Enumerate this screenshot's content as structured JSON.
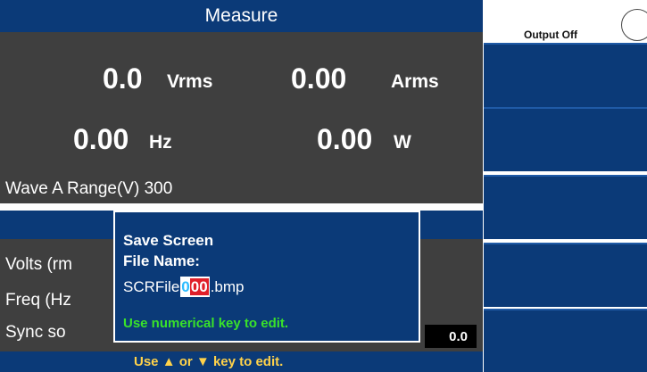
{
  "header": {
    "title": "Measure",
    "output_label": "Output Off"
  },
  "measure": {
    "voltage": {
      "value": "0.0",
      "unit": "Vrms"
    },
    "current": {
      "value": "0.00",
      "unit": "Arms"
    },
    "frequency": {
      "value": "0.00",
      "unit": "Hz"
    },
    "power": {
      "value": "0.00",
      "unit": "W"
    },
    "wave_info": "Wave A  Range(V) 300"
  },
  "settings": {
    "volts_label": "Volts (rm",
    "freq_label": "Freq (Hz",
    "sync_label": "Sync so",
    "sync_value": "0.0"
  },
  "dialog": {
    "title": "Save Screen",
    "filename_label": "File Name:",
    "filename_prefix": "SCRFile",
    "digit_cursor": "0",
    "digits_edit": "00",
    "filename_suffix": ".bmp",
    "hint": "Use numerical key to edit."
  },
  "bottom_hint": {
    "prefix": "Use",
    "up_arrow": "▲",
    "or": "or",
    "down_arrow": "▼",
    "suffix": "key to edit."
  },
  "softkeys": [
    "",
    "",
    "",
    "",
    ""
  ],
  "colors": {
    "panel_blue": "#0b3a78",
    "panel_gray": "#3f3f3f",
    "hint_green": "#39e22a",
    "hint_yellow": "#ffd24a",
    "edit_red": "#e0202a"
  }
}
